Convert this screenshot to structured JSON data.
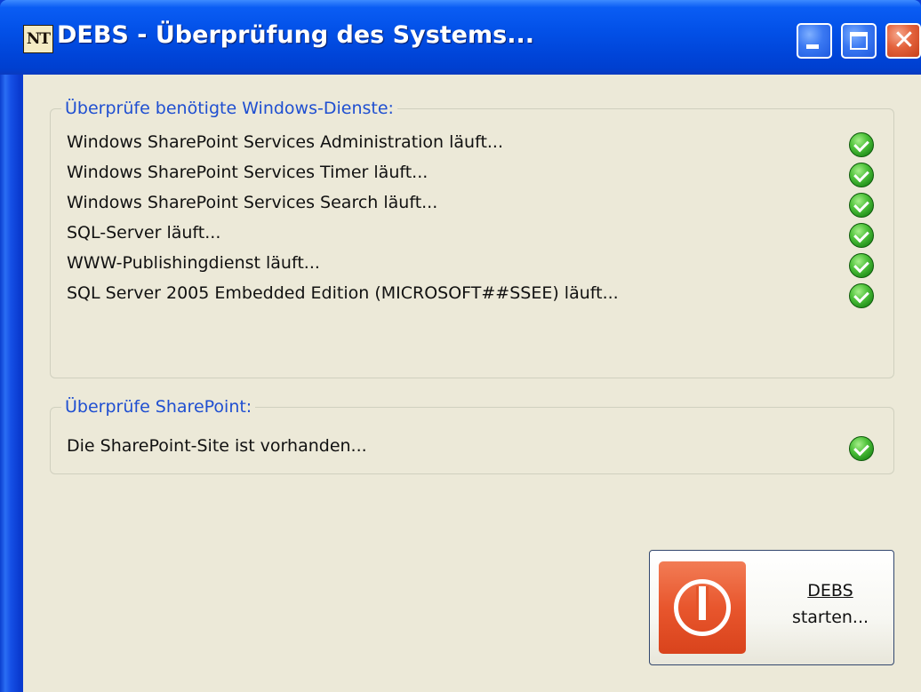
{
  "window": {
    "logo_text": "NT",
    "title": "DEBS - Überprüfung des Systems..."
  },
  "services_group": {
    "legend": "Überprüfe benötigte Windows-Dienste:",
    "items": [
      {
        "label": "Windows SharePoint Services Administration läuft...",
        "status": "ok"
      },
      {
        "label": "Windows SharePoint Services Timer läuft...",
        "status": "ok"
      },
      {
        "label": "Windows SharePoint Services Search läuft...",
        "status": "ok"
      },
      {
        "label": "SQL-Server läuft...",
        "status": "ok"
      },
      {
        "label": "WWW-Publishingdienst läuft...",
        "status": "ok"
      },
      {
        "label": "SQL Server 2005 Embedded Edition (MICROSOFT##SSEE) läuft...",
        "status": "ok"
      }
    ]
  },
  "sharepoint_group": {
    "legend": "Überprüfe SharePoint:",
    "items": [
      {
        "label": "Die SharePoint-Site ist vorhanden...",
        "status": "ok"
      }
    ]
  },
  "start_button": {
    "line1": "DEBS",
    "line2": "starten..."
  },
  "colors": {
    "titlebar": "#0351e8",
    "legend_text": "#1f4fd1",
    "client_bg": "#ece9d8",
    "check_green": "#4fc23b",
    "power_red": "#e8562d"
  }
}
